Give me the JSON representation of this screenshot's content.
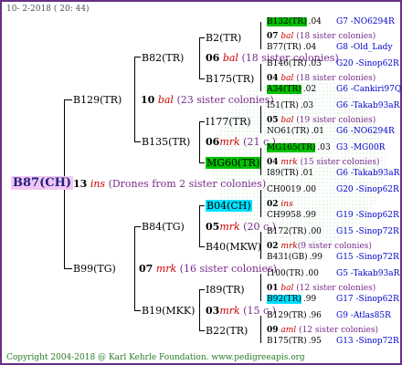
{
  "header": "10-  2-2018 ( 20: 44)",
  "footer": "Copyright 2004-2018 @ Karl Kehrle Foundation.   www.pedigreeapis.org",
  "root": {
    "name": "B87(CH)",
    "num": "13",
    "tag": "ins",
    "note": "(Drones from 2 sister colonies)"
  },
  "g1": [
    {
      "name": "B129(TR)",
      "num": "10",
      "tag": "bal",
      "note": "(23 sister colonies)"
    },
    {
      "name": "B99(TG)",
      "num": "07",
      "tag": "mrk",
      "note": "(16 sister colonies)"
    }
  ],
  "g2": [
    {
      "name": "B82(TR)"
    },
    {
      "name": "B135(TR)"
    },
    {
      "name": "B84(TG)"
    },
    {
      "name": "B19(MKK)"
    }
  ],
  "g3": [
    {
      "name": "B2(TR)",
      "num": "07",
      "tag": "bal",
      "note": "(19 c.)"
    },
    {
      "name": "B175(TR)",
      "num": "04",
      "tag": "bal",
      "note": "(18 sister colonies)"
    },
    {
      "name": "I177(TR)",
      "num": "05",
      "tag": "bal",
      "note": "(19 sister colonies)"
    },
    {
      "name": "MG60(TR)",
      "num": "04",
      "tag": "mrk",
      "note": "(15 sister colonies)"
    },
    {
      "name": "B04(CH)",
      "num": "02",
      "tag": "ins",
      "note": ""
    },
    {
      "name": "B40(MKW)",
      "num": "02",
      "tag": "mrk",
      "note": "(9 sister colonies)"
    },
    {
      "name": "I89(TR)",
      "num": "01",
      "tag": "bal",
      "note": "(12 sister colonies)"
    },
    {
      "name": "B22(TR)",
      "num": "09",
      "tag": "aml",
      "note": "(12 sister colonies)"
    }
  ],
  "g2mid": [
    {
      "num": "06",
      "tag": "bal",
      "note": "(18 sister colonies)"
    },
    {
      "num": "06",
      "tag": "mrk",
      "note": "(21 c.)"
    },
    {
      "num": "05",
      "tag": "mrk",
      "note": "(20 c.)"
    },
    {
      "num": "03",
      "tag": "mrk",
      "note": "(15 c.)"
    }
  ],
  "g4": [
    {
      "name": "B132(TR)",
      "v": ".04",
      "code": "G7 -NO6294R"
    },
    {
      "name": "B77(TR)",
      "v": ".04",
      "code": "G8 -Old_Lady"
    },
    {
      "name": "B146(TR)",
      "v": ".03",
      "code": "G20 -Sinop62R"
    },
    {
      "name": "A34(TR)",
      "v": ".02",
      "code": "G6 -Cankiri97Q"
    },
    {
      "name": "I51(TR)",
      "v": ".03",
      "code": "G6 -Takab93aR"
    },
    {
      "name": "NO61(TR)",
      "v": ".01",
      "code": "G6 -NO6294R"
    },
    {
      "name": "MG165(TR)",
      "v": ".03",
      "code": "G3 -MG00R"
    },
    {
      "name": "I89(TR)",
      "v": ".01",
      "code": "G6 -Takab93aR"
    },
    {
      "name": "CH0019",
      "v": ".00",
      "code": "G20 -Sinop62R"
    },
    {
      "name": "CH9958",
      "v": ".99",
      "code": "G19 -Sinop62R"
    },
    {
      "name": "B172(TR)",
      "v": ".00",
      "code": "G15 -Sinop72R"
    },
    {
      "name": "B431(GB)",
      "v": ".99",
      "code": "G15 -Sinop72R"
    },
    {
      "name": "I100(TR)",
      "v": ".00",
      "code": "G5 -Takab93aR"
    },
    {
      "name": "B92(TR)",
      "v": ".99",
      "code": "G17 -Sinop62R"
    },
    {
      "name": "B129(TR)",
      "v": ".96",
      "code": "G9 -Atlas85R"
    },
    {
      "name": "B175(TR)",
      "v": ".95",
      "code": "G13 -Sinop72R"
    }
  ]
}
